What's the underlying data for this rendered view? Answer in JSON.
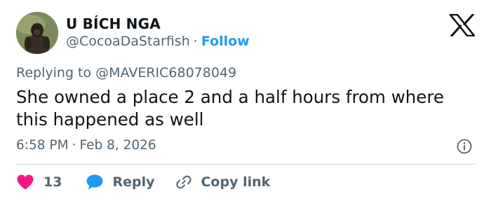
{
  "author": {
    "name": "U BÍCH NGA",
    "handle": "@CocoaDaStarfish",
    "separator": "·",
    "follow_label": "Follow"
  },
  "reply_context": {
    "prefix": "Replying to",
    "mention": "@MAVERIC68078049"
  },
  "tweet": {
    "text": "She owned a place 2 and a half hours from where this happened as well",
    "time": "6:58 PM",
    "separator": "·",
    "date": "Feb 8, 2026"
  },
  "actions": {
    "like_count": "13",
    "reply_label": "Reply",
    "copy_link_label": "Copy link"
  },
  "icons": {
    "brand": "x-logo-icon",
    "info": "info-icon",
    "like": "heart-icon",
    "reply": "speech-bubble-icon",
    "copy": "link-icon"
  },
  "colors": {
    "text": "#0f1419",
    "secondary": "#536471",
    "accent": "#1d9bf0",
    "like": "#f91880",
    "divider": "#cfd9de"
  }
}
